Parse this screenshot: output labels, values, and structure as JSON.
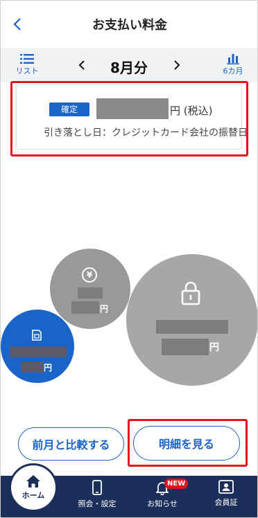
{
  "header": {
    "title": "お支払い料金"
  },
  "month_bar": {
    "list_label": "リスト",
    "month": "8月分",
    "six_month_label": "6カ月"
  },
  "summary": {
    "status_badge": "確定",
    "amount_unit": "円 (税込)",
    "debit_text": "引き落とし日：クレジットカード会社の振替日"
  },
  "bubbles": {
    "yen_symbol": "¥",
    "yen_unit": "円",
    "lock_unit": "円",
    "sim_unit": "円"
  },
  "actions": {
    "compare_label": "前月と比較する",
    "detail_label": "明細を見る"
  },
  "nav": {
    "home": "ホーム",
    "inquiry": "照会・設定",
    "notice": "お知らせ",
    "notice_badge": "NEW",
    "member": "会員証"
  },
  "colors": {
    "accent": "#1a63c9",
    "highlight": "#e3141d",
    "nav_bg": "#1c2f5a"
  }
}
